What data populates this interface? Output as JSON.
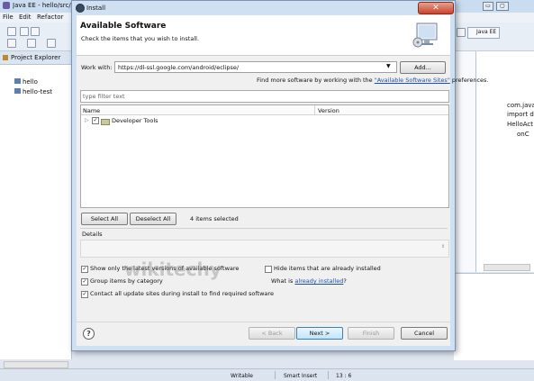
{
  "eclipse": {
    "window_title": "Java EE - hello/src/com",
    "menu": [
      "File",
      "Edit",
      "Refactor"
    ],
    "perspective": "Java EE",
    "project_explorer": {
      "tab": "Project Explorer",
      "items": [
        "hello",
        "hello-test"
      ]
    },
    "outline": {
      "items": [
        "com.java",
        "import d",
        "HelloAct",
        "onC"
      ]
    },
    "status": {
      "writable": "Writable",
      "insert_mode": "Smart Insert",
      "position": "13 : 6"
    }
  },
  "dialog": {
    "title": "Install",
    "heading": "Available Software",
    "subheading": "Check the items that you wish to install.",
    "work_with_label": "Work with:",
    "work_with_value": "https://dl-ssl.google.com/android/eclipse/",
    "add_button": "Add...",
    "find_more_prefix": "Find more software by working with the ",
    "find_more_link": "\"Available Software Sites\"",
    "find_more_suffix": " preferences.",
    "filter_placeholder": "type filter text",
    "columns": {
      "name": "Name",
      "version": "Version"
    },
    "tree_items": [
      {
        "label": "Developer Tools",
        "checked": true
      }
    ],
    "select_all": "Select All",
    "deselect_all": "Deselect All",
    "selected_count": "4 items selected",
    "details_label": "Details",
    "options": {
      "show_latest": {
        "label": "Show only the latest versions of available software",
        "checked": true
      },
      "group_by_category": {
        "label": "Group items by category",
        "checked": true
      },
      "contact_sites": {
        "label": "Contact all update sites during install to find required software",
        "checked": true
      },
      "hide_installed": {
        "label": "Hide items that are already installed",
        "checked": false
      }
    },
    "already_installed_prefix": "What is ",
    "already_installed_link": "already installed",
    "already_installed_suffix": "?",
    "back_button": "< Back",
    "next_button": "Next >",
    "finish_button": "Finish",
    "cancel_button": "Cancel",
    "watermark": "wikitechy"
  }
}
